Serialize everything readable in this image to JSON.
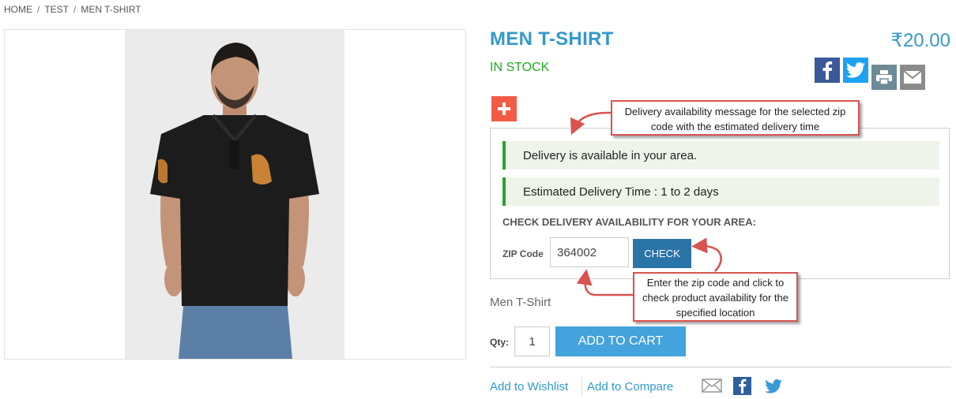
{
  "breadcrumb": [
    {
      "label": "HOME"
    },
    {
      "label": "TEST"
    },
    {
      "label": "MEN T-SHIRT"
    }
  ],
  "breadcrumb_separator": "/",
  "product": {
    "title": "MEN T-SHIRT",
    "price": "₹20.00",
    "stock_status": "IN STOCK",
    "name": "Men T-Shirt"
  },
  "share": {
    "icons": [
      "facebook-icon",
      "twitter-icon",
      "print-icon",
      "email-icon"
    ]
  },
  "delivery": {
    "available_message": "Delivery is available in your area.",
    "estimate_message": "Estimated Delivery Time : 1 to 2 days",
    "heading": "CHECK DELIVERY AVAILABILITY FOR YOUR AREA:",
    "zip_label": "ZIP Code",
    "zip_value": "364002",
    "check_label": "CHECK"
  },
  "callouts": {
    "top": "Delivery availability message for the selected zip code with the estimated delivery time",
    "bottom": "Enter the zip code and click to check product availability for the specified location"
  },
  "purchase": {
    "qty_label": "Qty:",
    "qty_value": "1",
    "add_to_cart": "ADD TO CART"
  },
  "links": {
    "wishlist": "Add to Wishlist",
    "compare": "Add to Compare"
  },
  "colors": {
    "accent": "#3399cc",
    "stock": "#22aa22",
    "cart_button": "#44a2dc",
    "check_button": "#2b74a8",
    "callout_border": "#d9534f",
    "plus_button": "#f25c46"
  }
}
